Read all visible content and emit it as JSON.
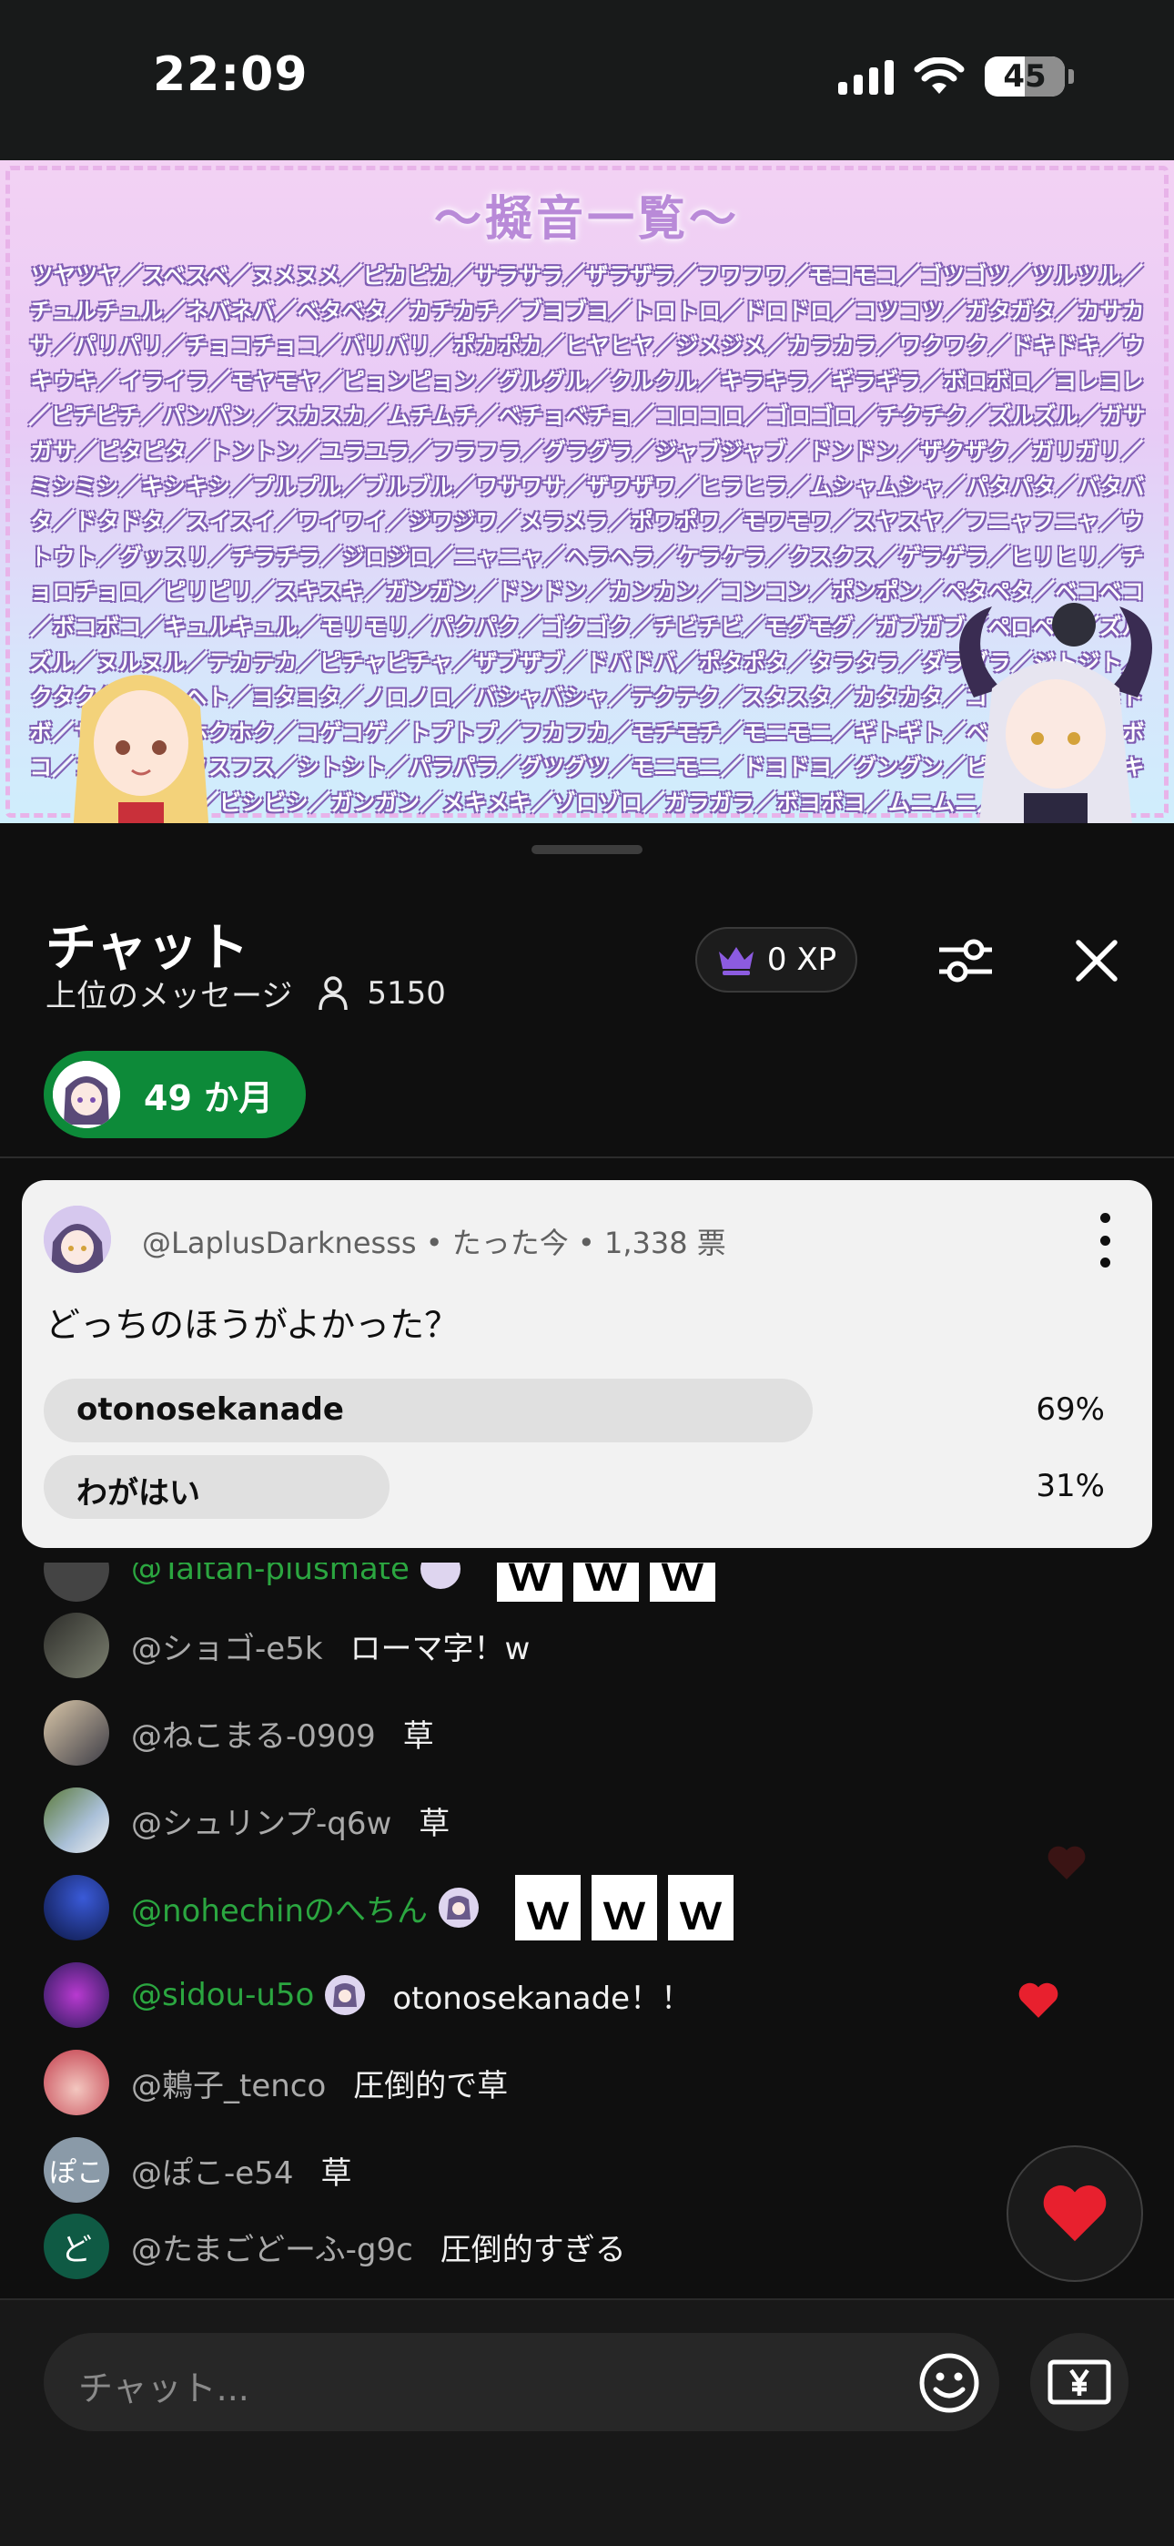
{
  "status": {
    "time": "22:09",
    "battery": "45"
  },
  "video": {
    "title": "〜擬音一覧〜",
    "onomatopoeia": "ツヤツヤ／スベスベ／ヌメヌメ／ピカピカ／サラサラ／ザラザラ／フワフワ／モコモコ／ゴツゴツ／ツルツル／チュルチュル／ネバネバ／ベタベタ／カチカチ／ブヨブヨ／トロトロ／ドロドロ／コツコツ／ガタガタ／カサカサ／パリパリ／チョコチョコ／バリバリ／ポカポカ／ヒヤヒヤ／ジメジメ／カラカラ／ワクワク／ドキドキ／ウキウキ／イライラ／モヤモヤ／ピョンピョン／グルグル／クルクル／キラキラ／ギラギラ／ボロボロ／ヨレヨレ／ピチピチ／パンパン／スカスカ／ムチムチ／ベチョベチョ／コロコロ／ゴロゴロ／チクチク／ズルズル／ガサガサ／ピタピタ／トントン／ユラユラ／フラフラ／グラグラ／ジャブジャブ／ドンドン／ザクザク／ガリガリ／ミシミシ／キシキシ／プルプル／ブルブル／ワサワサ／ザワザワ／ヒラヒラ／ムシャムシャ／パタパタ／バタバタ／ドタドタ／スイスイ／ワイワイ／ジワジワ／メラメラ／ポワポワ／モワモワ／スヤスヤ／フニャフニャ／ウトウト／グッスリ／チラチラ／ジロジロ／ニャニャ／ヘラヘラ／ケラケラ／クスクス／ゲラゲラ／ヒリヒリ／チョロチョロ／ピリピリ／スキスキ／ガンガン／ドンドン／カンカン／コンコン／ポンポン／ペタペタ／ベコベコ／ボコボコ／キュルキュル／モリモリ／パクパク／ゴクゴク／チビチビ／モグモグ／ガブガブ／ペロペロ／ズルズル／ヌルヌル／テカテカ／ピチャピチャ／ザブザブ／ドバドバ／ポタポタ／タラタラ／ダラダラ／ジトジト／クタクタ／ヘトヘト／ヨタヨタ／ノロノロ／バシャバシャ／テクテク／スタスタ／カタカタ／コトコト／トボトボ／サクサク／ホクホク／コゲコゲ／トプトプ／フカフカ／モチモチ／モニモニ／ギトギト／ベコベコ／ボコボコ／コボコボ／フスフス／シトシト／パラパラ／グツグツ／モニモニ／ドヨドヨ／グングン／ピンピン／キビキビ／ビシビシ／ガンガン／メキメキ／ゾロゾロ／ガラガラ／ボヨボヨ／ムニムニ／"
  },
  "chat": {
    "title": "チャット",
    "mode": "上位のメッセージ",
    "viewers": "5150",
    "xp": "0 XP",
    "membership": "49 か月"
  },
  "poll": {
    "author": "@LaplusDarknesss",
    "time": "たった今",
    "votes": "1,338 票",
    "question": "どっちのほうがよかった？",
    "options": [
      {
        "label": "otonosekanade",
        "percent": "69%",
        "share": 0.69
      },
      {
        "label": "わがはい",
        "percent": "31%",
        "share": 0.31
      }
    ]
  },
  "messages": [
    {
      "name": "@Taitan-plusmate",
      "text": "ｗｗｗ",
      "member": true
    },
    {
      "name": "@ショゴ-e5k",
      "text": "ローマ字！w",
      "member": false
    },
    {
      "name": "@ねこまる-0909",
      "text": "草",
      "member": false
    },
    {
      "name": "@シュリンプ-q6w",
      "text": "草",
      "member": false
    },
    {
      "name": "@nohechinのへちん",
      "text": "ｗｗｗ",
      "member": true
    },
    {
      "name": "@sidou-u5o",
      "text": "otonosekanade！！",
      "member": true
    },
    {
      "name": "@鶫子_tenco",
      "text": "圧倒的で草",
      "member": false
    },
    {
      "name": "@ぽこ-e54",
      "text": "草",
      "member": false,
      "avatar_letter": "ぽこ"
    },
    {
      "name": "@たまごどーふ-g9c",
      "text": "圧倒的すぎる",
      "member": false,
      "avatar_letter": "ど"
    }
  ],
  "input": {
    "placeholder": "チャット..."
  },
  "colors": {
    "member_green": "#2ba640",
    "pill_green": "#0d8a39",
    "heart_red": "#e8202e",
    "crown_purple": "#8c5be0"
  }
}
